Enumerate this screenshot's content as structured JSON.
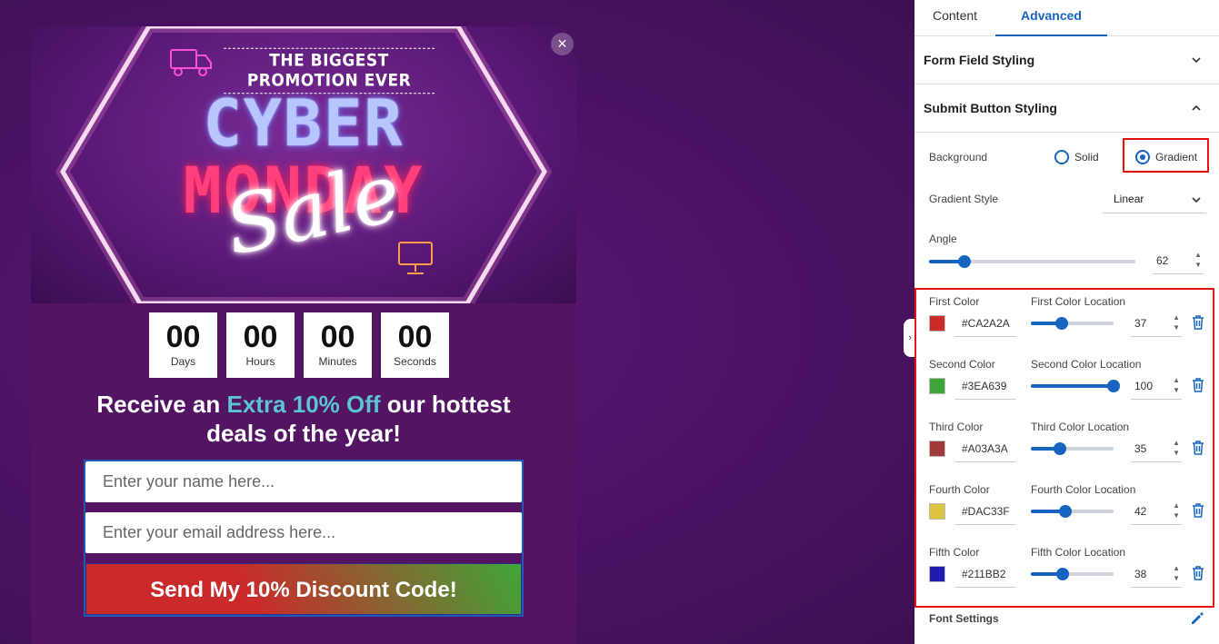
{
  "popup": {
    "hero_tag": "THE BIGGEST PROMOTION EVER",
    "hero_line1": "CYBER",
    "hero_line2": "MONDAY",
    "hero_script": "Sale",
    "close_icon": "×",
    "countdown": [
      {
        "num": "00",
        "label": "Days"
      },
      {
        "num": "00",
        "label": "Hours"
      },
      {
        "num": "00",
        "label": "Minutes"
      },
      {
        "num": "00",
        "label": "Seconds"
      }
    ],
    "headline_a": "Receive an ",
    "headline_hl": "Extra 10% Off",
    "headline_b": " our hottest deals of the year!",
    "name_placeholder": "Enter your name here...",
    "email_placeholder": "Enter your email address here...",
    "submit_label": "Send My 10% Discount Code!"
  },
  "panel": {
    "tabs": [
      "Content",
      "Advanced"
    ],
    "active_tab": "Advanced",
    "sections": {
      "form_field": "Form Field Styling",
      "submit_button": "Submit Button Styling"
    },
    "background_label": "Background",
    "bg_options": [
      "Solid",
      "Gradient"
    ],
    "bg_selected": "Gradient",
    "gradient_style_label": "Gradient Style",
    "gradient_style_value": "Linear",
    "angle_label": "Angle",
    "angle_value": "62",
    "angle_fraction": 0.17,
    "colors": [
      {
        "label": "First Color",
        "loc_label": "First Color Location",
        "hex": "#CA2A2A",
        "loc": "37",
        "fraction": 0.37
      },
      {
        "label": "Second Color",
        "loc_label": "Second Color Location",
        "hex": "#3EA639",
        "loc": "100",
        "fraction": 1.0
      },
      {
        "label": "Third Color",
        "loc_label": "Third Color Location",
        "hex": "#A03A3A",
        "loc": "35",
        "fraction": 0.35
      },
      {
        "label": "Fourth Color",
        "loc_label": "Fourth Color Location",
        "hex": "#DAC33F",
        "loc": "42",
        "fraction": 0.42
      },
      {
        "label": "Fifth Color",
        "loc_label": "Fifth Color Location",
        "hex": "#211BB2",
        "loc": "38",
        "fraction": 0.38
      }
    ],
    "font_settings_label": "Font Settings"
  },
  "colors": {
    "accent": "#1565c0",
    "highlight": "#e51010",
    "popup_bg": "#521463",
    "headline_accent": "#5bc4d2"
  }
}
